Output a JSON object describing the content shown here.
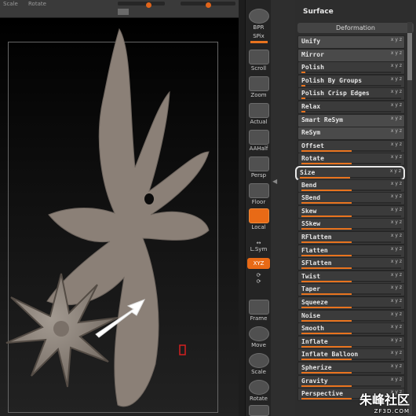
{
  "topbar": {
    "label_a": "Scale",
    "label_b": "Rotate"
  },
  "toolbar": {
    "items": [
      {
        "label": "BPR",
        "icon": "bpr-icon"
      },
      {
        "label": "SPix",
        "icon": "spix-slider-icon"
      },
      {
        "label": "Scroll",
        "icon": "scroll-hand-icon"
      },
      {
        "label": "Zoom",
        "icon": "zoom-icon"
      },
      {
        "label": "Actual",
        "icon": "actual-size-icon"
      },
      {
        "label": "AAHalf",
        "icon": "aahalf-icon"
      },
      {
        "label": "Persp",
        "icon": "perspective-icon"
      },
      {
        "label": "Floor",
        "icon": "floor-grid-icon"
      },
      {
        "label": "Local",
        "icon": "local-transform-icon",
        "active": true
      },
      {
        "label": "L.Sym",
        "icon": "local-symmetry-icon"
      },
      {
        "label": "XYZ",
        "icon": "xyz-rotate-icon",
        "active": true
      },
      {
        "label": "Frame",
        "icon": "frame-icon"
      },
      {
        "label": "Move",
        "icon": "move-hand-icon"
      },
      {
        "label": "Scale",
        "icon": "scale-icon"
      },
      {
        "label": "Rotate",
        "icon": "rotate-icon"
      }
    ]
  },
  "panel": {
    "title": "Surface",
    "section": "Deformation",
    "rows": [
      {
        "label": "Unify",
        "type": "button"
      },
      {
        "label": "Mirror",
        "type": "button"
      },
      {
        "label": "Polish",
        "type": "slider",
        "value": 0.0
      },
      {
        "label": "Polish By Groups",
        "type": "slider",
        "value": 0.0
      },
      {
        "label": "Polish Crisp Edges",
        "type": "slider",
        "value": 0.0
      },
      {
        "label": "Relax",
        "type": "slider",
        "value": 0.0
      },
      {
        "label": "Smart ReSym",
        "type": "button"
      },
      {
        "label": "ReSym",
        "type": "button"
      },
      {
        "label": "Offset",
        "type": "slider",
        "value": 0.5
      },
      {
        "label": "Rotate",
        "type": "slider",
        "value": 0.5
      },
      {
        "label": "Size",
        "type": "slider",
        "value": 0.5,
        "highlighted": true
      },
      {
        "label": "Bend",
        "type": "slider",
        "value": 0.5
      },
      {
        "label": "SBend",
        "type": "slider",
        "value": 0.5
      },
      {
        "label": "Skew",
        "type": "slider",
        "value": 0.5
      },
      {
        "label": "SSkew",
        "type": "slider",
        "value": 0.5
      },
      {
        "label": "RFlatten",
        "type": "slider",
        "value": 0.5
      },
      {
        "label": "Flatten",
        "type": "slider",
        "value": 0.5
      },
      {
        "label": "SFlatten",
        "type": "slider",
        "value": 0.5
      },
      {
        "label": "Twist",
        "type": "slider",
        "value": 0.5
      },
      {
        "label": "Taper",
        "type": "slider",
        "value": 0.5
      },
      {
        "label": "Squeeze",
        "type": "slider",
        "value": 0.5
      },
      {
        "label": "Noise",
        "type": "slider",
        "value": 0.5
      },
      {
        "label": "Smooth",
        "type": "slider",
        "value": 0.5
      },
      {
        "label": "Inflate",
        "type": "slider",
        "value": 0.5
      },
      {
        "label": "Inflate Balloon",
        "type": "slider",
        "value": 0.5
      },
      {
        "label": "Spherize",
        "type": "slider",
        "value": 0.5
      },
      {
        "label": "Gravity",
        "type": "slider",
        "value": 0.5
      },
      {
        "label": "Perspective",
        "type": "slider",
        "value": 0.5
      }
    ]
  },
  "watermark": {
    "logo": "朱峰社区",
    "url": "ZF3D.COM"
  },
  "colors": {
    "accent": "#e8731e",
    "model": "#8d8279"
  }
}
